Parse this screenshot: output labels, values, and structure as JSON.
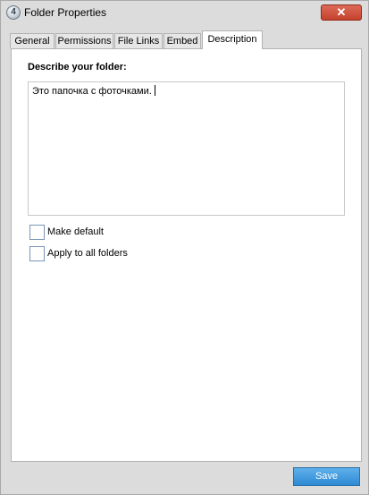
{
  "window": {
    "title": "Folder Properties",
    "app_icon_glyph": "4",
    "close_glyph": "✕"
  },
  "tabs": [
    {
      "label": "General",
      "active": false
    },
    {
      "label": "Permissions",
      "active": false
    },
    {
      "label": "File Links",
      "active": false
    },
    {
      "label": "Embed",
      "active": false
    },
    {
      "label": "Description",
      "active": true
    }
  ],
  "description": {
    "heading": "Describe your folder:",
    "value": "Это папочка с фоточками."
  },
  "options": {
    "make_default": {
      "label": "Make default",
      "checked": false
    },
    "apply_all": {
      "label": "Apply to all folders",
      "checked": false
    }
  },
  "footer": {
    "save_label": "Save"
  },
  "colors": {
    "accent": "#3a94dc",
    "close": "#c9503b"
  }
}
